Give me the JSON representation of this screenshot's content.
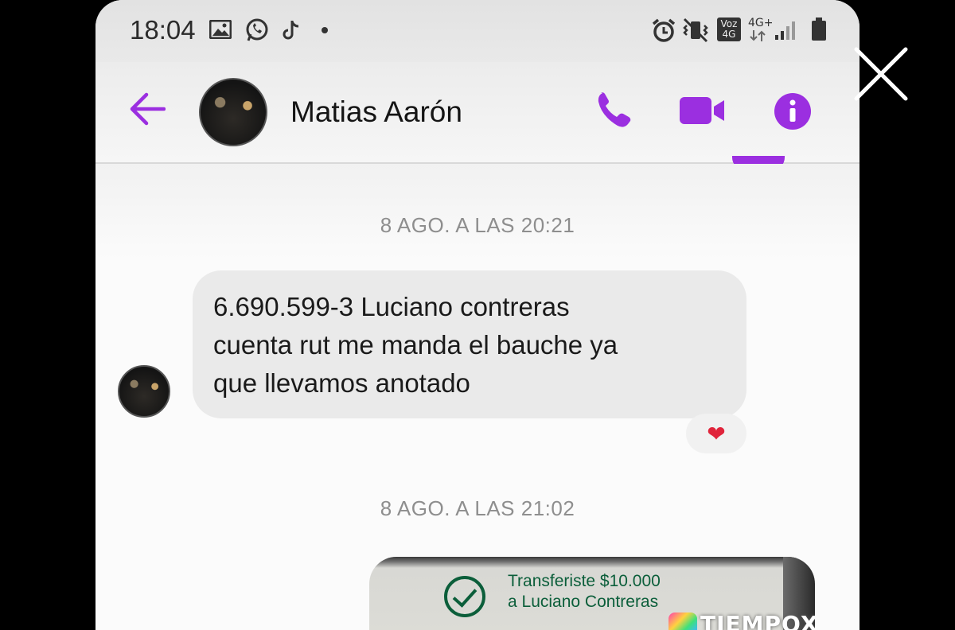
{
  "status_bar": {
    "time": "18:04",
    "left_icons": [
      "gallery-icon",
      "whatsapp-icon",
      "tiktok-icon",
      "dot-icon"
    ],
    "right_icons": [
      "alarm-icon",
      "vibrate-icon",
      "volte-icon",
      "4g-icon",
      "signal-icon",
      "battery-icon"
    ],
    "volte_label": "Voz 4G",
    "network_label": "4G+"
  },
  "header": {
    "contact_name": "Matias Aarón",
    "actions": [
      "call-icon",
      "video-icon",
      "info-icon"
    ],
    "accent_color": "#9b2fe0"
  },
  "messages": [
    {
      "type": "timestamp",
      "text": "8 AGO. A LAS 20:21"
    },
    {
      "type": "incoming",
      "lines": [
        "6.690.599-3 Luciano contreras",
        "cuenta rut me manda el bauche ya",
        "que llevamos anotado"
      ],
      "reaction": "❤"
    },
    {
      "type": "timestamp",
      "text": "8 AGO. A LAS 21:02"
    },
    {
      "type": "outgoing_image",
      "text_lines": [
        "Transferiste $10.000",
        "a Luciano Contreras"
      ],
      "watermark": "TIEMPOX"
    }
  ]
}
